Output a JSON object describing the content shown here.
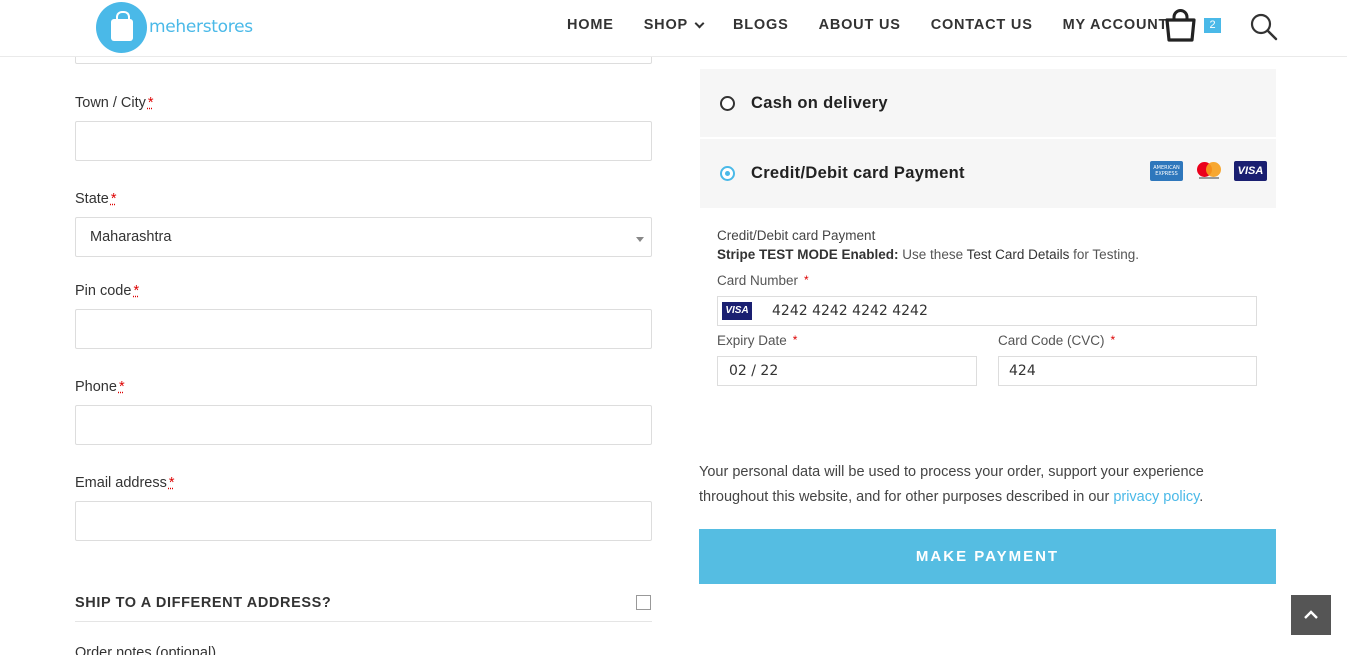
{
  "header": {
    "logo_text": "meherstores",
    "nav": [
      {
        "label": "HOME"
      },
      {
        "label": "SHOP"
      },
      {
        "label": "BLOGS"
      },
      {
        "label": "ABOUT US"
      },
      {
        "label": "CONTACT US"
      },
      {
        "label": "MY ACCOUNT"
      }
    ],
    "cart_count": "2",
    "accent_color": "#4ab9e8"
  },
  "billing": {
    "town_label": "Town / City",
    "state_label": "State",
    "state_value": "Maharashtra",
    "pin_label": "Pin code",
    "phone_label": "Phone",
    "email_label": "Email address",
    "required_mark": "*",
    "ship_different": "SHIP TO A DIFFERENT ADDRESS?",
    "order_notes_label": "Order notes (optional)"
  },
  "payment": {
    "cod_label": "Cash on delivery",
    "card_label": "Credit/Debit card Payment",
    "card_logos": [
      "amex-icon",
      "mastercard-icon",
      "visa-icon"
    ],
    "amex_text": "AMERICAN EXPRESS",
    "visa_text": "VISA",
    "stripe_desc": "Credit/Debit card Payment",
    "stripe_mode_bold": "Stripe TEST MODE Enabled:",
    "stripe_mode_text1": "Use these",
    "stripe_mode_link": "Test Card Details",
    "stripe_mode_text2": "for Testing.",
    "card_number_label": "Card Number",
    "card_number_value": "4242 4242 4242 4242",
    "expiry_label": "Expiry Date",
    "expiry_value": "02 / 22",
    "cvc_label": "Card Code (CVC)",
    "cvc_value": "424",
    "privacy_text": "Your personal data will be used to process your order, support your experience throughout this website, and for other purposes described in our",
    "privacy_link": "privacy policy",
    "privacy_end": ".",
    "make_payment": "MAKE PAYMENT"
  }
}
